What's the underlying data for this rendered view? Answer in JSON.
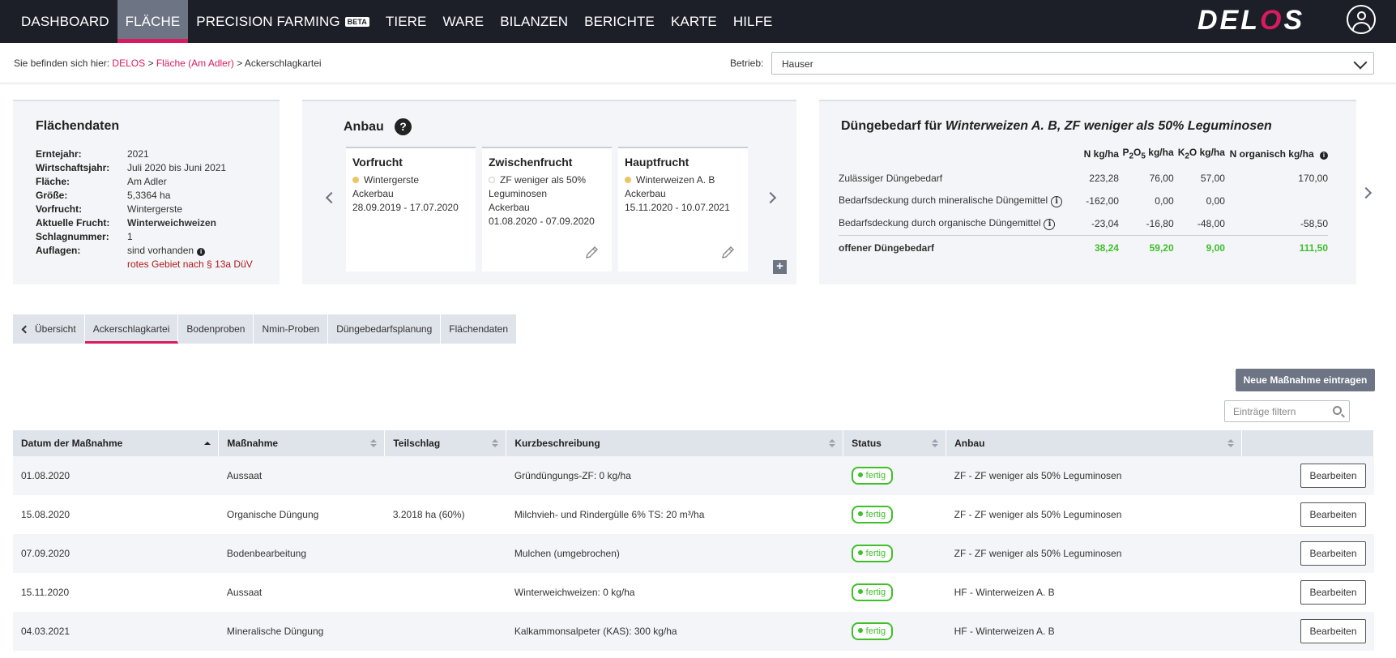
{
  "nav": {
    "items": [
      "DASHBOARD",
      "FLÄCHE",
      "PRECISION FARMING",
      "TIERE",
      "WARE",
      "BILANZEN",
      "BERICHTE",
      "KARTE",
      "HILFE"
    ],
    "beta": "BETA",
    "logo_a": "DEL",
    "logo_o": "O",
    "logo_b": "S"
  },
  "breadcrumb": {
    "prefix": "Sie befinden sich hier:",
    "l1": "DELOS",
    "sep1": ">",
    "l2": "Fläche (Am Adler)",
    "sep2": ">",
    "current": "Ackerschlagkartei"
  },
  "betrieb": {
    "label": "Betrieb:",
    "value": "Hauser"
  },
  "flaechendaten": {
    "title": "Flächendaten",
    "rows": [
      {
        "label": "Erntejahr:",
        "value": "2021"
      },
      {
        "label": "Wirtschaftsjahr:",
        "value": "Juli 2020 bis Juni 2021"
      },
      {
        "label": "Fläche:",
        "value": "Am Adler"
      },
      {
        "label": "Größe:",
        "value": "5,3364 ha"
      },
      {
        "label": "Vorfrucht:",
        "value": "Wintergerste"
      },
      {
        "label": "Aktuelle Frucht:",
        "value": "Winterweichweizen"
      },
      {
        "label": "Schlagnummer:",
        "value": "1"
      },
      {
        "label": "Auflagen:",
        "value": "sind vorhanden"
      }
    ],
    "auflage_note": "rotes Gebiet nach § 13a DüV"
  },
  "anbau": {
    "title": "Anbau",
    "help": "?",
    "boxes": [
      {
        "title": "Vorfrucht",
        "name": "Wintergerste",
        "type": "Ackerbau",
        "dates": "28.09.2019 - 17.07.2020"
      },
      {
        "title": "Zwischenfrucht",
        "name": "ZF weniger als 50%",
        "name2": "Leguminosen",
        "type": "Ackerbau",
        "dates": "01.08.2020 - 07.09.2020"
      },
      {
        "title": "Hauptfrucht",
        "name": "Winterweizen A. B",
        "type": "Ackerbau",
        "dates": "15.11.2020 - 10.07.2021"
      }
    ],
    "plus": "+"
  },
  "duengebedarf": {
    "title_prefix": "Düngebedarf für",
    "title_crop": "Winterweizen A. B, ZF weniger als 50% Leguminosen",
    "headers": {
      "n": "N kg/ha",
      "p_a": "P",
      "p_sub": "2",
      "p_b": "O",
      "p_sub2": "5",
      "p_unit": " kg/ha",
      "k_a": "K",
      "k_sub": "2",
      "k_b": "O kg/ha",
      "norg": "N organisch kg/ha"
    },
    "rows": [
      {
        "label": "Zulässiger Düngebedarf",
        "n": "223,28",
        "p": "76,00",
        "k": "57,00",
        "norg": "170,00"
      },
      {
        "label": "Bedarfsdeckung durch mineralische Düngemittel",
        "n": "-162,00",
        "p": "0,00",
        "k": "0,00",
        "norg": ""
      },
      {
        "label": "Bedarfsdeckung durch organische Düngemittel",
        "n": "-23,04",
        "p": "-16,80",
        "k": "-48,00",
        "norg": "-58,50"
      }
    ],
    "sum": {
      "label": "offener Düngebedarf",
      "n": "38,24",
      "p": "59,20",
      "k": "9,00",
      "norg": "111,50"
    },
    "info": "i"
  },
  "tabs": [
    "Übersicht",
    "Ackerschlagkartei",
    "Bodenproben",
    "Nmin-Proben",
    "Düngebedarfsplanung",
    "Flächendaten"
  ],
  "actions": {
    "new_label": "Neue Maßnahme eintragen",
    "filter_placeholder": "Einträge filtern"
  },
  "table": {
    "headers": [
      "Datum der Maßnahme",
      "Maßnahme",
      "Teilschlag",
      "Kurzbeschreibung",
      "Status",
      "Anbau"
    ],
    "rows": [
      {
        "datum": "01.08.2020",
        "massnahme": "Aussaat",
        "teilschlag": "",
        "kurz": "Gründüngungs-ZF: 0 kg/ha",
        "status": "fertig",
        "anbau": "ZF - ZF weniger als 50% Leguminosen",
        "action": "Bearbeiten"
      },
      {
        "datum": "15.08.2020",
        "massnahme": "Organische Düngung",
        "teilschlag": "3.2018 ha (60%)",
        "kurz": "Milchvieh- und Rindergülle 6% TS: 20 m³/ha",
        "status": "fertig",
        "anbau": "ZF - ZF weniger als 50% Leguminosen",
        "action": "Bearbeiten"
      },
      {
        "datum": "07.09.2020",
        "massnahme": "Bodenbearbeitung",
        "teilschlag": "",
        "kurz": "Mulchen (umgebrochen)",
        "status": "fertig",
        "anbau": "ZF - ZF weniger als 50% Leguminosen",
        "action": "Bearbeiten"
      },
      {
        "datum": "15.11.2020",
        "massnahme": "Aussaat",
        "teilschlag": "",
        "kurz": "Winterweichweizen: 0 kg/ha",
        "status": "fertig",
        "anbau": "HF - Winterweizen A. B",
        "action": "Bearbeiten"
      },
      {
        "datum": "04.03.2021",
        "massnahme": "Mineralische Düngung",
        "teilschlag": "",
        "kurz": "Kalkammonsalpeter (KAS): 300 kg/ha",
        "status": "fertig",
        "anbau": "HF - Winterweizen A. B",
        "action": "Bearbeiten"
      }
    ]
  },
  "colors": {
    "accent": "#d81b60",
    "nav_bg": "#1c1f28",
    "status_green": "#3fbf2a",
    "button_grey": "#6d7483"
  }
}
